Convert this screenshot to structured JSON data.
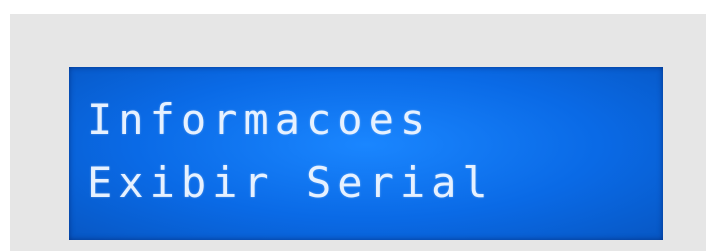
{
  "display": {
    "lines": [
      "Informacoes",
      "Exibir Serial"
    ],
    "colors": {
      "background": "#e6e6e6",
      "screen": "#0a6ae6",
      "text": "#e6f1ff"
    }
  }
}
